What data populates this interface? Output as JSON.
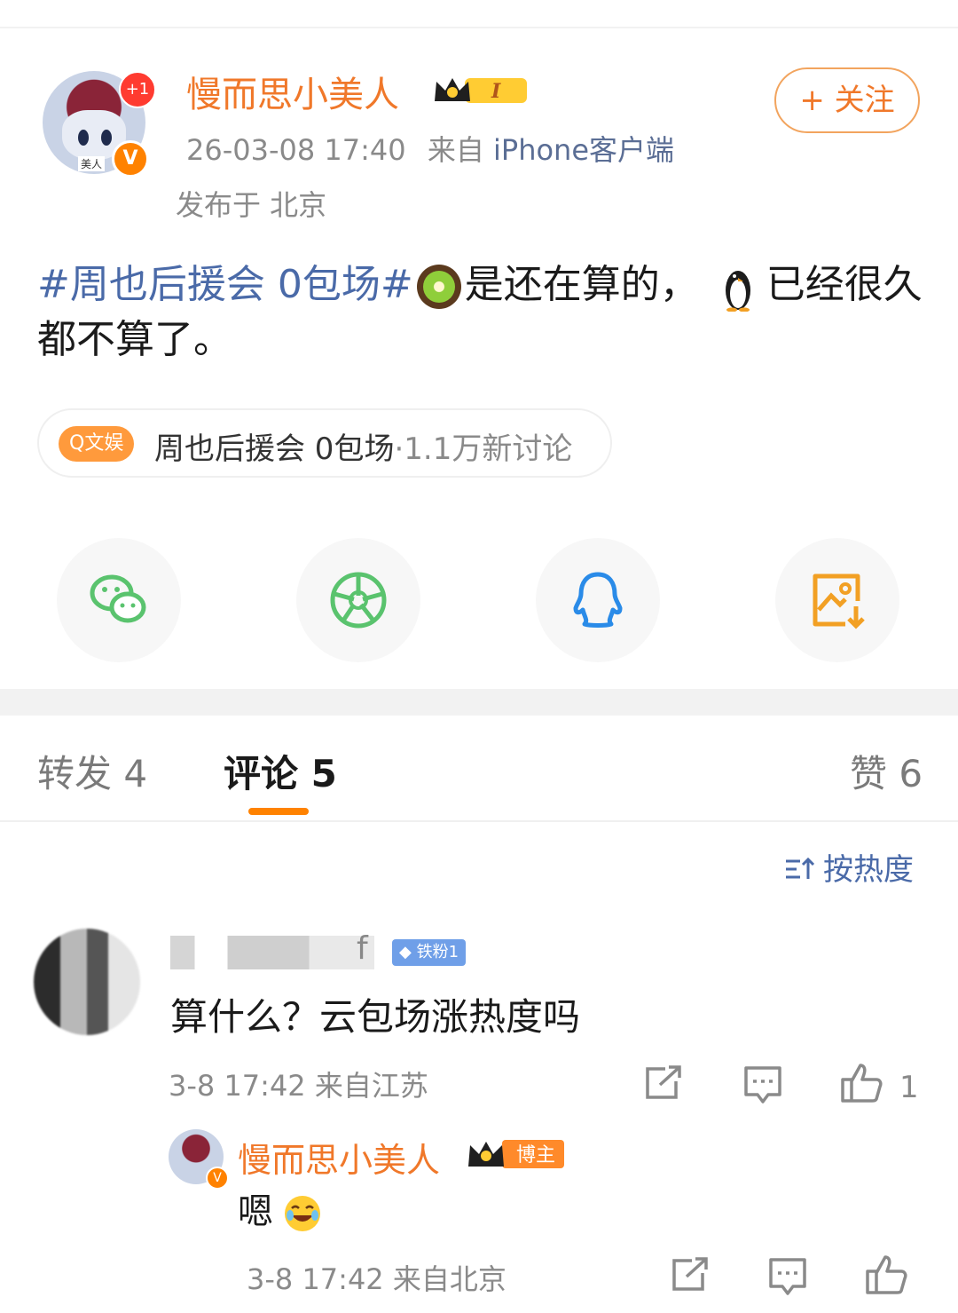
{
  "post": {
    "username": "慢而思小美人",
    "avatar_badge": "+1",
    "avatar_tag": "美人",
    "verified_mark": "V",
    "level_badge": "I",
    "time": "26-03-08 17:40",
    "source_prefix": "来自",
    "source": "iPhone客户端",
    "location": "发布于 北京",
    "follow_label": "+ 关注",
    "topic": "#周也后援会 0包场#",
    "text_part1": "是还在算的，",
    "text_part2": "已经很久都不算了。",
    "emoji_1": "kiwi",
    "emoji_2": "penguin"
  },
  "topic_chip": {
    "tag": "Q文娱",
    "name": "周也后援会 0包场",
    "stats": "·1.1万新讨论"
  },
  "share_buttons": [
    {
      "name": "wechat-icon",
      "color": "#5ac36e"
    },
    {
      "name": "moments-icon",
      "color": "#5ac36e"
    },
    {
      "name": "qq-icon",
      "color": "#2a8be8"
    },
    {
      "name": "save-image-icon",
      "color": "#f2a024"
    }
  ],
  "tabs": {
    "repost": "转发 4",
    "comment": "评论 5",
    "like": "赞 6"
  },
  "sort_label": "按热度",
  "comment": {
    "name_tail": "f",
    "fan_badge": "铁粉1",
    "text": "算什么？云包场涨热度吗",
    "meta": "3-8 17:42 来自江苏",
    "like_count": "1"
  },
  "reply": {
    "username": "慢而思小美人",
    "role_badge": "博主",
    "text": "嗯",
    "meta": "3-8 17:42 来自北京"
  },
  "colors": {
    "accent": "#ff8200",
    "username": "#f0782a",
    "topic": "#4a6aa8"
  }
}
